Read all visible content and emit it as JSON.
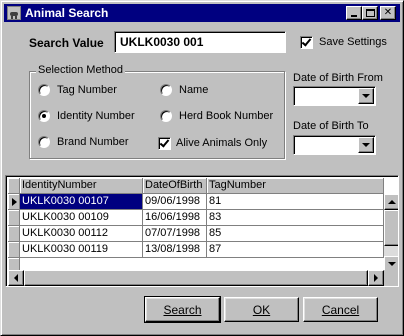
{
  "window": {
    "title": "Animal Search",
    "icon": "cow-icon"
  },
  "search": {
    "label": "Search Value",
    "value": "UKLK0030 001"
  },
  "save_settings": {
    "label": "Save Settings",
    "checked": true
  },
  "selection_method": {
    "title": "Selection Method",
    "options": [
      {
        "label": "Tag Number",
        "selected": false
      },
      {
        "label": "Name",
        "selected": false
      },
      {
        "label": "Identity Number",
        "selected": true
      },
      {
        "label": "Herd Book Number",
        "selected": false
      },
      {
        "label": "Brand Number",
        "selected": false
      }
    ],
    "alive_only": {
      "label": "Alive Animals Only",
      "checked": true
    }
  },
  "dob_from": {
    "label": "Date of Birth From",
    "value": ""
  },
  "dob_to": {
    "label": "Date of Birth To",
    "value": ""
  },
  "grid": {
    "columns": [
      "IdentityNumber",
      "DateOfBirth",
      "TagNumber"
    ],
    "rows": [
      [
        "UKLK0030 00107",
        "09/06/1998",
        "81"
      ],
      [
        "UKLK0030 00109",
        "16/06/1998",
        "83"
      ],
      [
        "UKLK0030 00112",
        "07/07/1998",
        "85"
      ],
      [
        "UKLK0030 00119",
        "13/08/1998",
        "87"
      ]
    ],
    "selected_row": 0
  },
  "buttons": {
    "search": "Search",
    "ok": "OK",
    "cancel": "Cancel"
  },
  "colors": {
    "titlebar": "#000080",
    "face": "#c0c0c0",
    "selection": "#000080"
  }
}
